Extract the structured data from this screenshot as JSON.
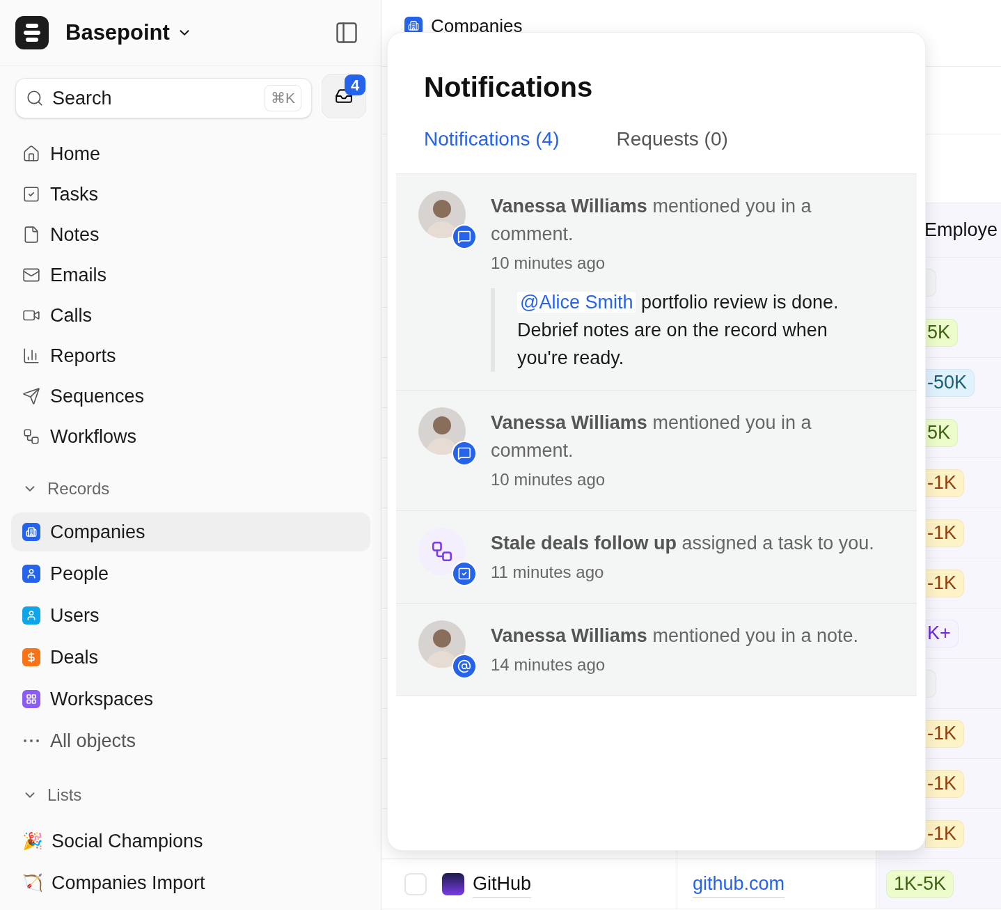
{
  "workspace": {
    "name": "Basepoint"
  },
  "search": {
    "placeholder": "Search",
    "shortcut": "⌘K"
  },
  "inbox": {
    "badge": "4"
  },
  "nav": [
    {
      "label": "Home"
    },
    {
      "label": "Tasks"
    },
    {
      "label": "Notes"
    },
    {
      "label": "Emails"
    },
    {
      "label": "Calls"
    },
    {
      "label": "Reports"
    },
    {
      "label": "Sequences"
    },
    {
      "label": "Workflows"
    }
  ],
  "records": {
    "title": "Records",
    "expanded": true,
    "items": [
      {
        "label": "Companies",
        "selected": true,
        "color": "#2563eb"
      },
      {
        "label": "People",
        "selected": false,
        "color": "#2563eb"
      },
      {
        "label": "Users",
        "selected": false,
        "color": "#0ea5e9"
      },
      {
        "label": "Deals",
        "selected": false,
        "color": "#f97316"
      },
      {
        "label": "Workspaces",
        "selected": false,
        "color": "#8b5cf6"
      }
    ],
    "more": "All objects"
  },
  "lists": {
    "title": "Lists",
    "expanded": true,
    "items": [
      {
        "emoji": "🎉",
        "label": "Social Champions"
      },
      {
        "emoji": "🏹",
        "label": "Companies Import"
      }
    ]
  },
  "page": {
    "title": "Companies"
  },
  "table": {
    "column_3": "Employe",
    "rows": [
      {
        "employees": "",
        "color": "#f3f4f6"
      },
      {
        "employees": "5K",
        "color": "#ecfccb"
      },
      {
        "employees": "-50K",
        "color": "#e0f2fe"
      },
      {
        "employees": "5K",
        "color": "#ecfccb"
      },
      {
        "employees": "-1K",
        "color": "#fef3c7"
      },
      {
        "employees": "-1K",
        "color": "#fef3c7"
      },
      {
        "employees": "-1K",
        "color": "#fef3c7"
      },
      {
        "employees": "K+",
        "color": "#f5f3ff"
      },
      {
        "employees": "",
        "color": "#f3f4f6"
      },
      {
        "employees": "-1K",
        "color": "#fef3c7"
      },
      {
        "employees": "-1K",
        "color": "#fef3c7"
      },
      {
        "employees": "-1K",
        "color": "#fef3c7"
      },
      {
        "name": "GitHub",
        "selected": false,
        "domain": "github.com",
        "employees": "1K-5K",
        "color": "#ecfccb"
      }
    ]
  },
  "notifications": {
    "title": "Notifications",
    "tabs": [
      {
        "label": "Notifications (4)",
        "selected": true
      },
      {
        "label": "Requests (0)",
        "selected": false
      }
    ],
    "items": [
      {
        "kind": "comment",
        "actor": "Vanessa Williams",
        "action": "mentioned you in a comment.",
        "time": "10 minutes ago",
        "quote": {
          "mention": "@Alice Smith",
          "text": "portfolio review is done. Debrief notes are on the record when you're ready."
        }
      },
      {
        "kind": "comment",
        "actor": "Vanessa Williams",
        "action": "mentioned you in a comment.",
        "time": "10 minutes ago"
      },
      {
        "kind": "task",
        "actor": "Stale deals follow up",
        "action": "assigned a task to you.",
        "time": "11 minutes ago"
      },
      {
        "kind": "mention",
        "actor": "Vanessa Williams",
        "action": "mentioned you in a note.",
        "time": "14 minutes ago"
      }
    ]
  }
}
